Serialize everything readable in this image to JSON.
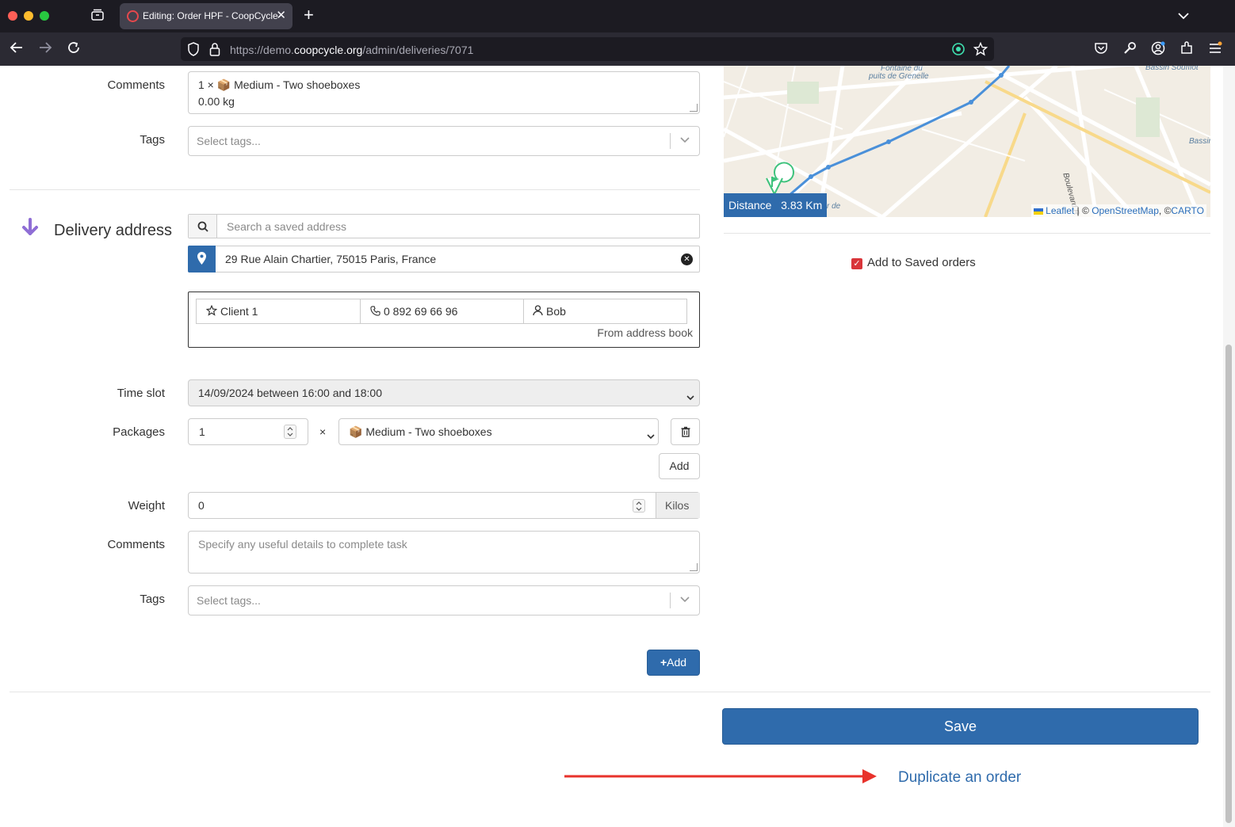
{
  "browser": {
    "tab_title": "Editing: Order HPF - CoopCycle",
    "url_host_prefix": "https://demo.",
    "url_host_main": "coopcycle.org",
    "url_path": "/admin/deliveries/7071"
  },
  "pickup": {
    "comments_label": "Comments",
    "comments_line1": "1 × 📦 Medium - Two shoeboxes",
    "comments_line2": "0.00 kg",
    "tags_label": "Tags",
    "tags_placeholder": "Select tags..."
  },
  "delivery": {
    "section_title": "Delivery address",
    "search_placeholder": "Search a saved address",
    "address_value": "29 Rue Alain Chartier, 75015 Paris, France",
    "contact_name": "Client 1",
    "contact_phone": "0 892 69 66 96",
    "contact_person": "Bob",
    "from_address_book": "From address book",
    "time_slot_label": "Time slot",
    "time_slot_value": "14/09/2024 between 16:00 and 18:00",
    "packages_label": "Packages",
    "packages_quantity": "1",
    "packages_times": "×",
    "packages_type": "📦 Medium - Two shoeboxes",
    "packages_add_label": "Add",
    "weight_label": "Weight",
    "weight_value": "0",
    "weight_unit": "Kilos",
    "comments_label": "Comments",
    "comments_placeholder": "Specify any useful details to complete task",
    "tags_label": "Tags",
    "tags_placeholder": "Select tags...",
    "add_task_label": "Add"
  },
  "map": {
    "distance_label": "Distance",
    "distance_value": "3.83 Km",
    "attr_leaflet": "Leaflet",
    "attr_sep1": "| ©",
    "attr_osm": "OpenStreetMap",
    "attr_sep2": ", ©",
    "attr_carto": "CARTO",
    "label_fontaine": "Fontaine du",
    "label_puits": "puits de Grenelle",
    "label_bassin1": "Bassin Soufflot",
    "label_bassin2": "Bassin",
    "label_boulevard": "Boulevard R",
    "label_rue": "r de"
  },
  "saved_orders": {
    "checked": true,
    "label": "Add to Saved orders"
  },
  "actions": {
    "save_label": "Save",
    "duplicate_label": "Duplicate an order"
  },
  "colors": {
    "primary": "#2f6bac",
    "accent_red": "#e8322b",
    "section_arrow": "#8f6ed5"
  }
}
